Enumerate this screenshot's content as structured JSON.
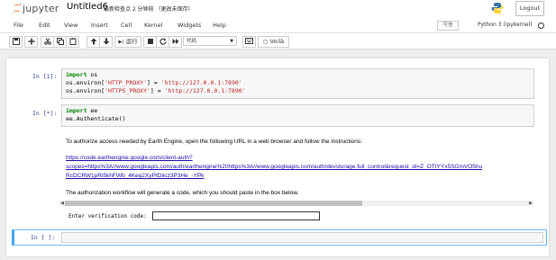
{
  "header": {
    "logo_text": "jupyter",
    "notebook_title": "Untitled6",
    "checkpoint_text": "最新检查点 2 分钟前 （更改未保存）",
    "logout_label": "Logout"
  },
  "menu": {
    "items": [
      "File",
      "Edit",
      "View",
      "Insert",
      "Cell",
      "Kernel",
      "Widgets",
      "Help"
    ],
    "trusted_label": "可信",
    "kernel_name": "Python 3 (ipykernel)"
  },
  "toolbar": {
    "run_label": "运行",
    "cell_type": "代码",
    "voila_label": "Voilà"
  },
  "cells": {
    "cell1": {
      "prompt": "In  [1]:",
      "line1_kw": "import",
      "line1_rest": " os",
      "line2_pre": "os.environ[",
      "line2_key": "'HTTP_PROXY'",
      "line2_mid": "] = ",
      "line2_val": "'http://127.0.0.1:7890'",
      "line3_pre": "os.environ[",
      "line3_key": "'HTTPS_PROXY'",
      "line3_mid": "] = ",
      "line3_val": "'http://127.0.0.1:7890'"
    },
    "cell2": {
      "prompt": "In  [*]:",
      "line1_kw": "import",
      "line1_rest": " ee",
      "line2": "ee.Authenticate()",
      "output_intro": "To authorize access needed by Earth Engine, open the following URL in a web browser and follow the instructions:",
      "url_line1": "https://code.earthengine.google.com/client-auth?",
      "url_line2": "scopes=https%3A//www.googleapis.com/auth/earthengine%20https%3A//www.googleapis.com/auth/devstorage.full_control&request_id=Z_OTtYYx5SGmVO5hu",
      "url_line3": "RcDCRW1pRi5khFWb_4Keq2XyPtDiicz3P3He_-YPk",
      "workflow_text": "The authorization workflow will generate a code, which you should paste in the box below.",
      "verify_label": "Enter verification code:",
      "verify_value": ""
    },
    "cell3": {
      "prompt": "In  [ ]:"
    }
  },
  "colors": {
    "prompt_in": "#303f9f",
    "keyword": "#008000",
    "string": "#ba2121",
    "selected_cell_border": "#42a5f5",
    "link": "#1a0dab"
  }
}
